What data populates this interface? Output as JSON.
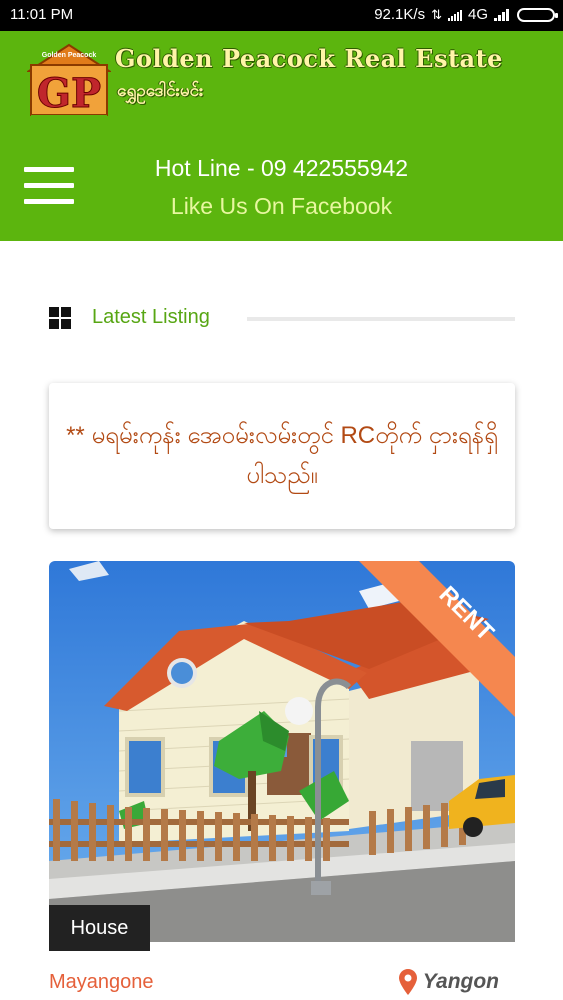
{
  "status_bar": {
    "time": "11:01 PM",
    "speed": "92.1K/s",
    "network": "4G"
  },
  "header": {
    "logo_text": "GP",
    "logo_caption": "Golden Peacock",
    "brand_name": "Golden Peacock Real Estate",
    "brand_name_mm": "ရွှေဥဒေါင်းမင်း",
    "hotline": "Hot Line - 09 422555942",
    "facebook_link": "Like Us On Facebook"
  },
  "section": {
    "title": "Latest Listing"
  },
  "notice": {
    "text": "** မရမ်းကုန်း အေဝမ်းလမ်းတွင် RCတိုက် ငှားရန်ရှိပါသည်။"
  },
  "listing": {
    "ribbon": "RENT",
    "type": "House",
    "area": "Mayangone",
    "city": "Yangon"
  },
  "colors": {
    "header_green": "#5cb50e",
    "accent_orange": "#f5874f",
    "notice_text": "#b24a14",
    "area_text": "#e5603a"
  },
  "icons": [
    "hamburger-menu-icon",
    "grid-icon",
    "map-pin-icon",
    "battery-icon",
    "signal-icon"
  ]
}
